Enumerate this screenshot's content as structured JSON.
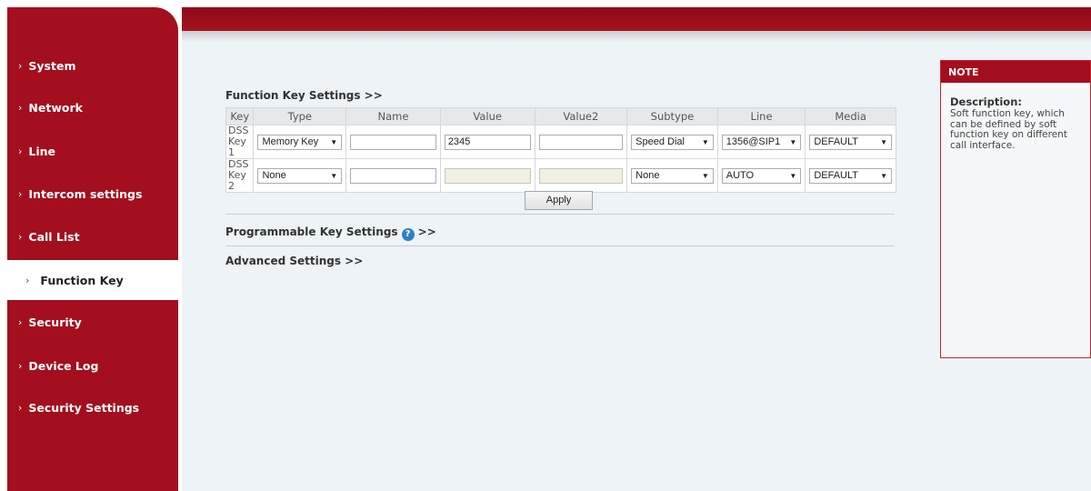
{
  "sidebar": {
    "items": [
      {
        "label": "System"
      },
      {
        "label": "Network"
      },
      {
        "label": "Line"
      },
      {
        "label": "Intercom settings"
      },
      {
        "label": "Call List"
      },
      {
        "label": "Function Key",
        "active": true
      },
      {
        "label": "Security"
      },
      {
        "label": "Device Log"
      },
      {
        "label": "Security Settings"
      }
    ]
  },
  "function_key": {
    "title": "Function Key Settings >>",
    "columns": [
      "Key",
      "Type",
      "Name",
      "Value",
      "Value2",
      "Subtype",
      "Line",
      "Media"
    ],
    "rows": [
      {
        "key": "DSS Key 1",
        "type": "Memory Key",
        "name": "",
        "value": "2345",
        "value2": "",
        "subtype": "Speed Dial",
        "line": "1356@SIP1",
        "media": "DEFAULT"
      },
      {
        "key": "DSS Key 2",
        "type": "None",
        "name": "",
        "value": "",
        "value2": "",
        "subtype": "None",
        "line": "AUTO",
        "media": "DEFAULT"
      }
    ],
    "apply_label": "Apply"
  },
  "programmable": {
    "title": "Programmable Key Settings",
    "suffix": ">>"
  },
  "advanced": {
    "title": "Advanced Settings >>"
  },
  "note": {
    "header": "NOTE",
    "title": "Description:",
    "body": "Soft function key, which can be defined by soft function key on different call interface."
  },
  "icons": {
    "chevron": "chevron-right-icon",
    "help": "help-circle-icon"
  },
  "colors": {
    "brand": "#a30f1e",
    "content_bg": "#edf3f7",
    "help_blue": "#2f7ec7"
  }
}
